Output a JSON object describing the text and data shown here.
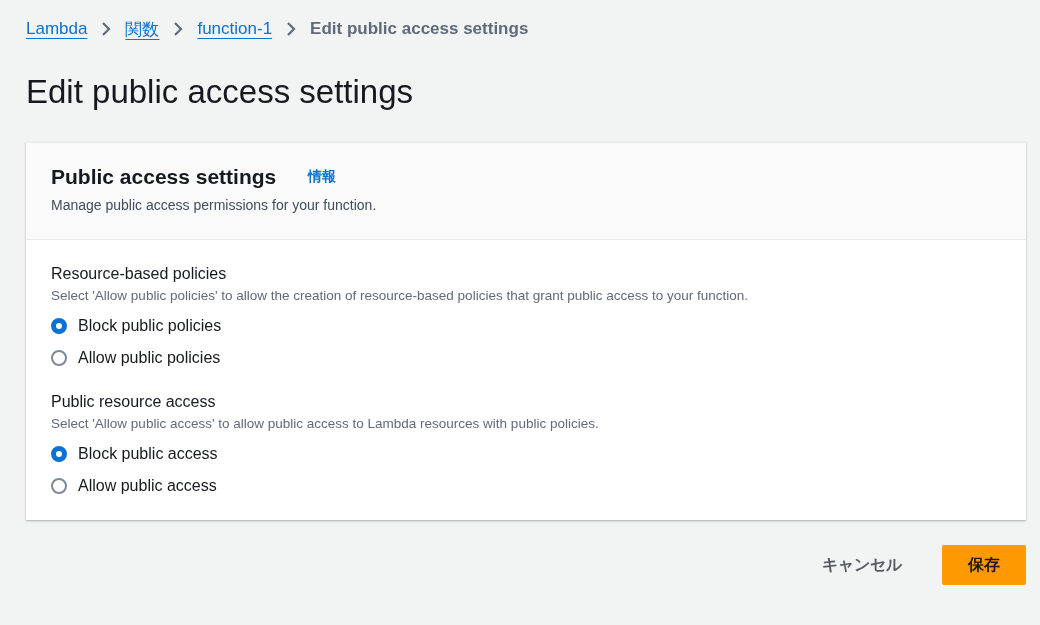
{
  "breadcrumb": [
    {
      "label": "Lambda",
      "kind": "link"
    },
    {
      "label": "関数",
      "kind": "link"
    },
    {
      "label": "function-1",
      "kind": "link"
    },
    {
      "label": "Edit public access settings",
      "kind": "current"
    }
  ],
  "page_title": "Edit public access settings",
  "panel": {
    "title": "Public access settings",
    "info_link": "情報",
    "description": "Manage public access permissions for your function.",
    "groups": [
      {
        "label": "Resource-based policies",
        "description": "Select 'Allow public policies' to allow the creation of resource-based policies that grant public access to your function.",
        "options": [
          {
            "label": "Block public policies",
            "selected": true
          },
          {
            "label": "Allow public policies",
            "selected": false
          }
        ]
      },
      {
        "label": "Public resource access",
        "description": "Select 'Allow public access' to allow public access to Lambda resources with public policies.",
        "options": [
          {
            "label": "Block public access",
            "selected": true
          },
          {
            "label": "Allow public access",
            "selected": false
          }
        ]
      }
    ]
  },
  "buttons": [
    {
      "label": "キャンセル",
      "kind": "secondary"
    },
    {
      "label": "保存",
      "kind": "primary"
    }
  ]
}
